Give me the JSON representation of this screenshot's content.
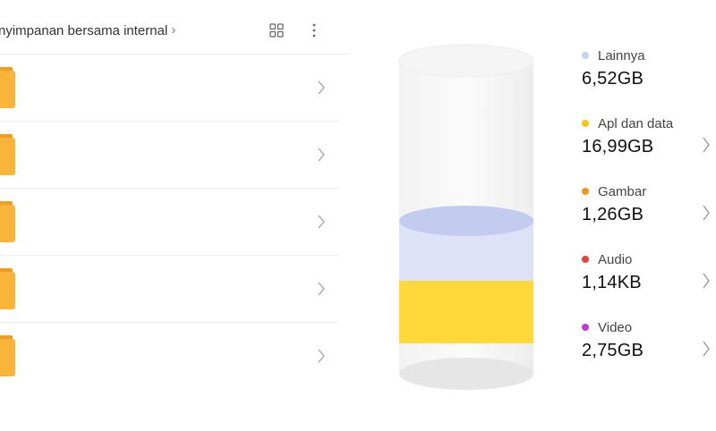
{
  "breadcrumb": {
    "path": "nyimpanan bersama internal"
  },
  "icons": {
    "view_toggle": "grid-view-icon",
    "overflow": "more-vertical-icon",
    "row_chevron": "chevron-right-icon"
  },
  "folders": [
    {
      "icon": "folder-icon"
    },
    {
      "icon": "folder-icon"
    },
    {
      "icon": "folder-icon"
    },
    {
      "icon": "folder-icon"
    },
    {
      "icon": "folder-icon"
    }
  ],
  "storage": {
    "categories": [
      {
        "name": "Lainnya",
        "size": "6,52GB",
        "color": "#c9d0ee"
      },
      {
        "name": "Apl dan data",
        "size": "16,99GB",
        "color": "#f5c518"
      },
      {
        "name": "Gambar",
        "size": "1,26GB",
        "color": "#f0961c"
      },
      {
        "name": "Audio",
        "size": "1,14KB",
        "color": "#e8413a"
      },
      {
        "name": "Video",
        "size": "2,75GB",
        "color": "#c23ad6"
      }
    ]
  },
  "colors": {
    "folder": "#f9b53a",
    "folder_tab": "#f29b21",
    "cylinder_glass": "#eeeeee",
    "fill_yellow": "#ffd83a",
    "fill_lavender": "#d3d9f3"
  }
}
